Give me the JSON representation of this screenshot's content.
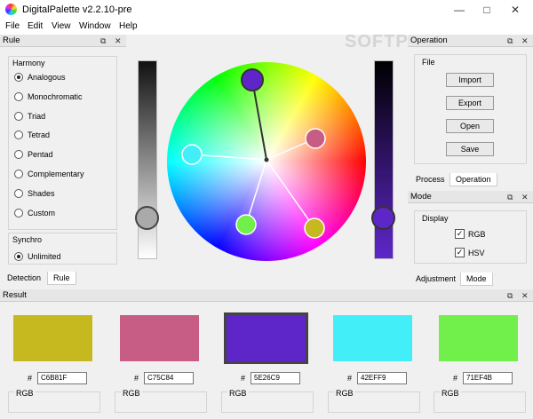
{
  "window": {
    "title": "DigitalPalette v2.2.10-pre",
    "min": "—",
    "max": "□",
    "close": "✕"
  },
  "menu": [
    "File",
    "Edit",
    "View",
    "Window",
    "Help"
  ],
  "watermark": "SOFTPEDIA",
  "rule_panel": {
    "title": "Rule",
    "harmony_label": "Harmony",
    "options": [
      "Analogous",
      "Monochromatic",
      "Triad",
      "Tetrad",
      "Pentad",
      "Complementary",
      "Shades",
      "Custom"
    ],
    "selected_index": 0,
    "synchro_label": "Synchro",
    "synchro_option": "Unlimited",
    "tabs": [
      "Detection",
      "Rule"
    ],
    "active_tab": 1
  },
  "operation_panel": {
    "title": "Operation",
    "file_label": "File",
    "buttons": [
      "Import",
      "Export",
      "Open",
      "Save"
    ],
    "tabs": [
      "Process",
      "Operation"
    ],
    "active_tab": 1
  },
  "mode_panel": {
    "title": "Mode",
    "display_label": "Display",
    "checks": [
      "RGB",
      "HSV"
    ],
    "tabs": [
      "Adjustment",
      "Mode"
    ],
    "active_tab": 1
  },
  "result_panel": {
    "title": "Result",
    "swatches": [
      {
        "hex": "C6B81F",
        "color": "#C6B81F",
        "label": "RGB"
      },
      {
        "hex": "C75C84",
        "color": "#C75C84",
        "label": "RGB"
      },
      {
        "hex": "5E26C9",
        "color": "#5E26C9",
        "label": "RGB"
      },
      {
        "hex": "42EFF9",
        "color": "#42EFF9",
        "label": "RGB"
      },
      {
        "hex": "71EF4B",
        "color": "#71EF4B",
        "label": "RGB"
      }
    ],
    "selected_index": 2,
    "hash": "#"
  },
  "panel_btn_float": "⧉",
  "panel_btn_close": "✕"
}
